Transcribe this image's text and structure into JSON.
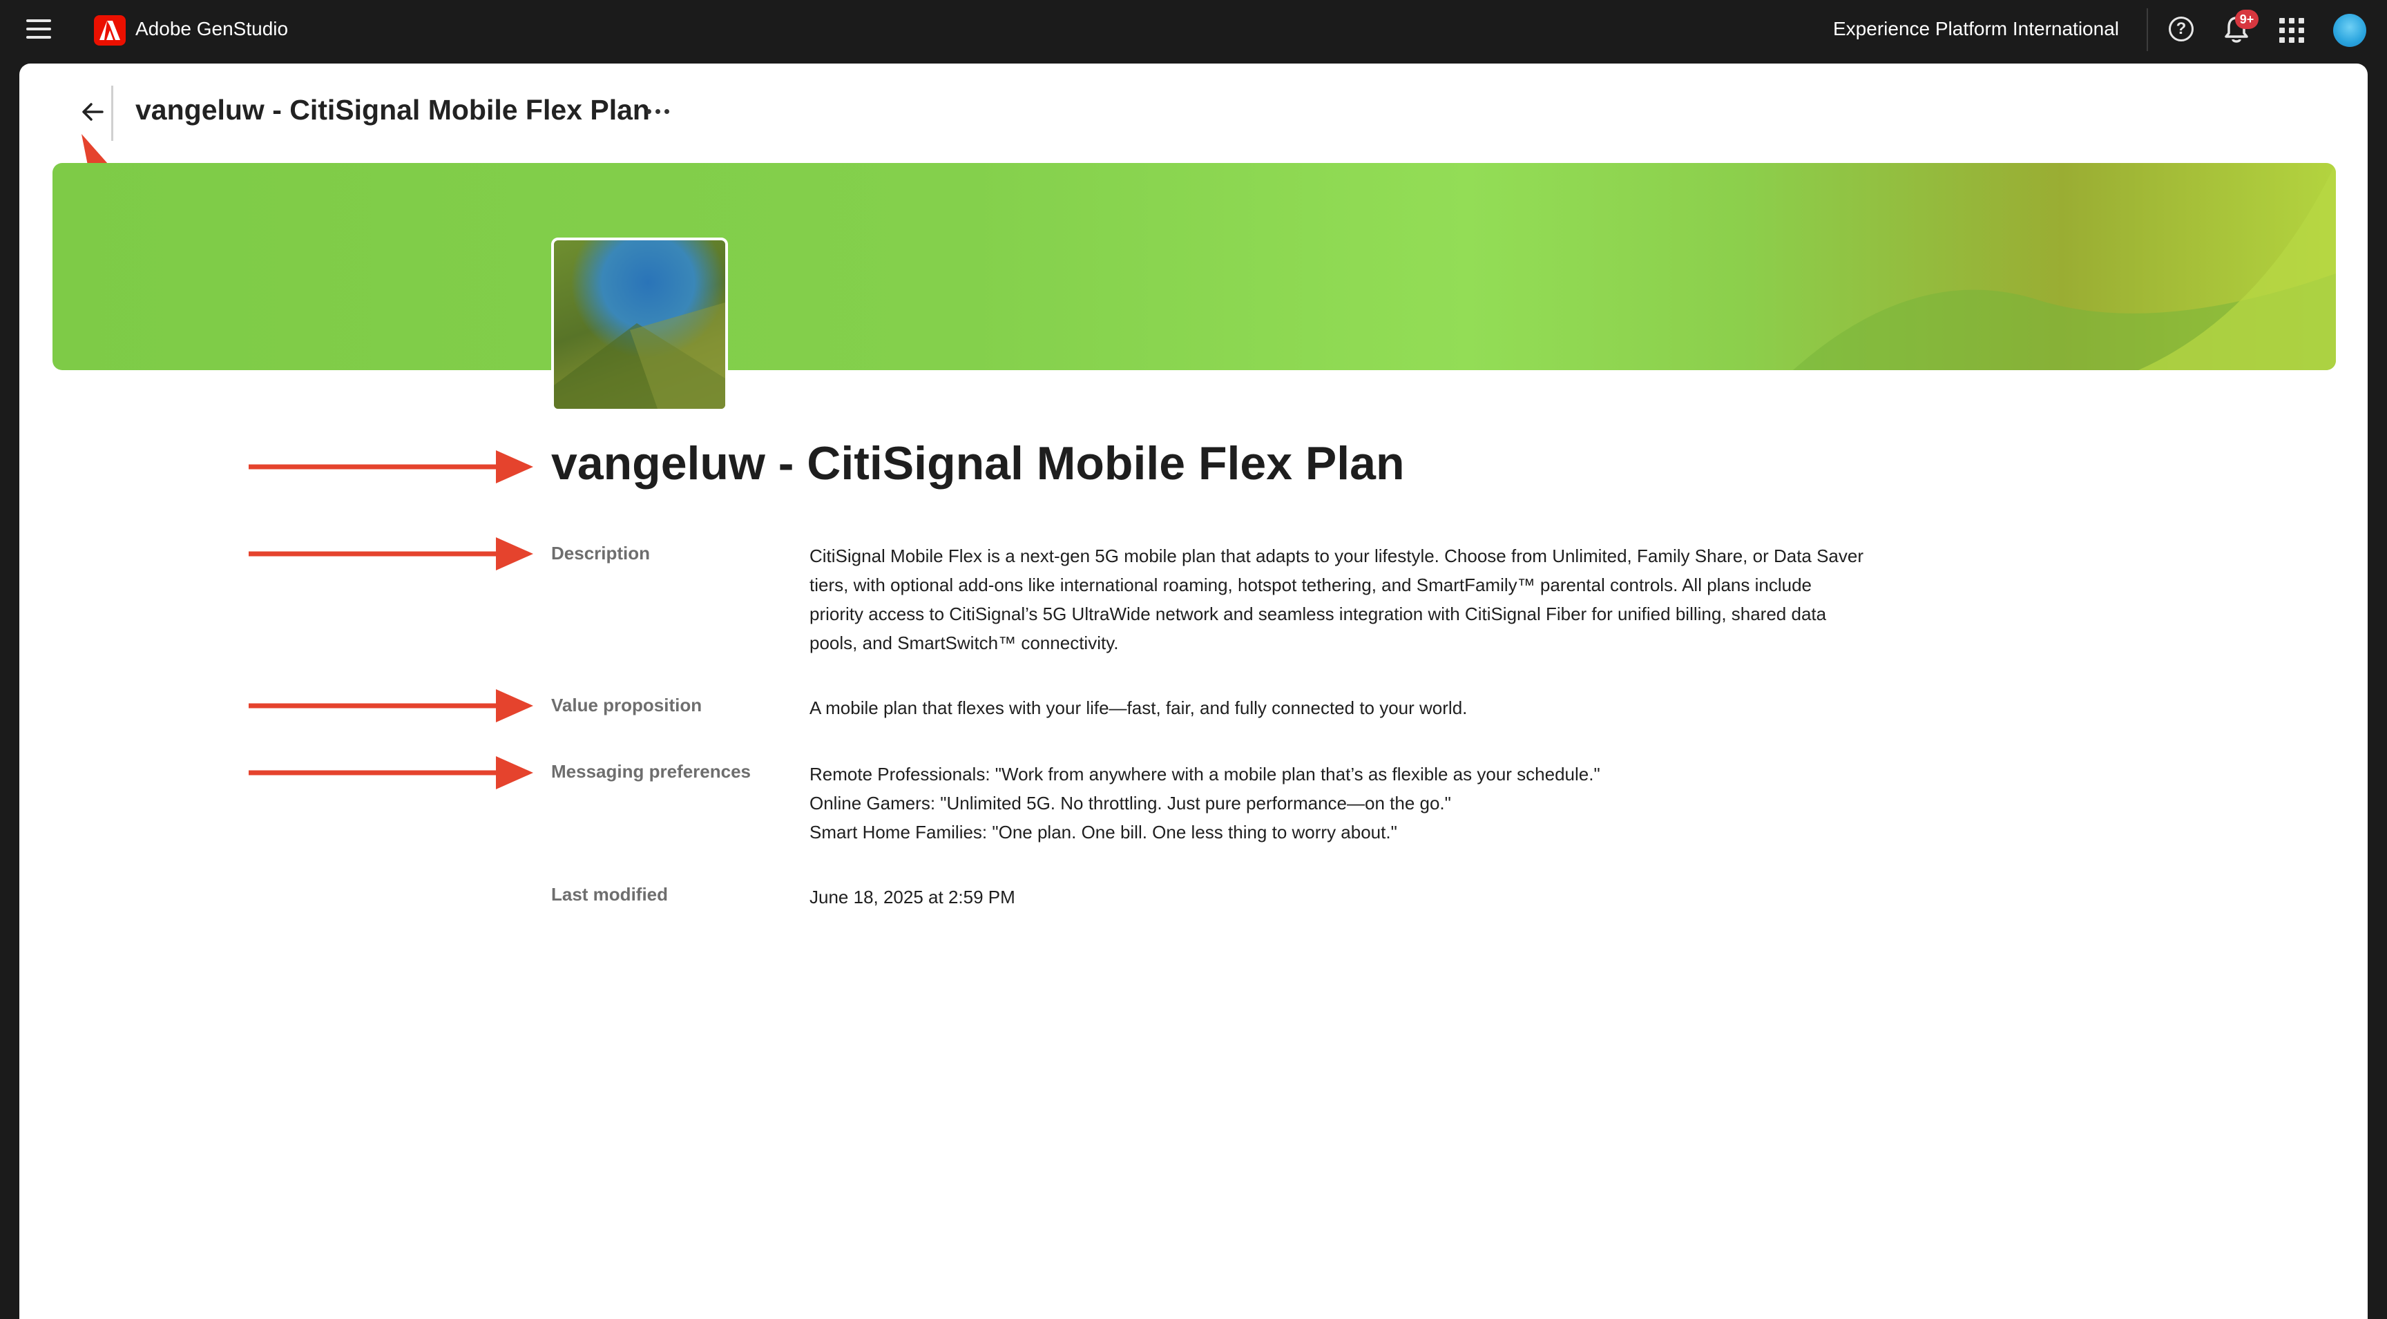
{
  "topbar": {
    "app_name": "Adobe GenStudio",
    "org_name": "Experience Platform International",
    "notification_badge": "9+"
  },
  "header": {
    "title": "vangeluw - CitiSignal Mobile Flex Plan"
  },
  "product": {
    "title": "vangeluw - CitiSignal Mobile Flex Plan",
    "fields": {
      "description": {
        "label": "Description",
        "lines": [
          "CitiSignal Mobile Flex is a next-gen 5G mobile plan that adapts to your lifestyle. Choose from Unlimited, Family Share, or Data Saver",
          "tiers, with optional add-ons like international roaming, hotspot tethering, and SmartFamily™ parental controls. All plans include",
          "priority access to CitiSignal’s 5G UltraWide network and seamless integration with CitiSignal Fiber for unified billing, shared data",
          "pools, and SmartSwitch™ connectivity."
        ]
      },
      "value_proposition": {
        "label": "Value proposition",
        "value": "A mobile plan that flexes with your life—fast, fair, and fully connected to your world."
      },
      "messaging_preferences": {
        "label": "Messaging preferences",
        "lines": [
          "Remote Professionals: \"Work from anywhere with a mobile plan that’s as flexible as your schedule.\"",
          "Online Gamers: \"Unlimited 5G. No throttling. Just pure performance—on the go.\"",
          "Smart Home Families: \"One plan. One bill. One less thing to worry about.\""
        ]
      },
      "last_modified": {
        "label": "Last modified",
        "value": "June 18, 2025 at 2:59 PM"
      }
    }
  },
  "colors": {
    "annotation_arrow": "#e5432d",
    "brand_red": "#eb1000",
    "banner_green": "#84d04c"
  },
  "icons": [
    "hamburger-icon",
    "adobe-logo-icon",
    "help-icon",
    "bell-icon",
    "apps-grid-icon",
    "back-arrow-icon",
    "more-icon"
  ]
}
